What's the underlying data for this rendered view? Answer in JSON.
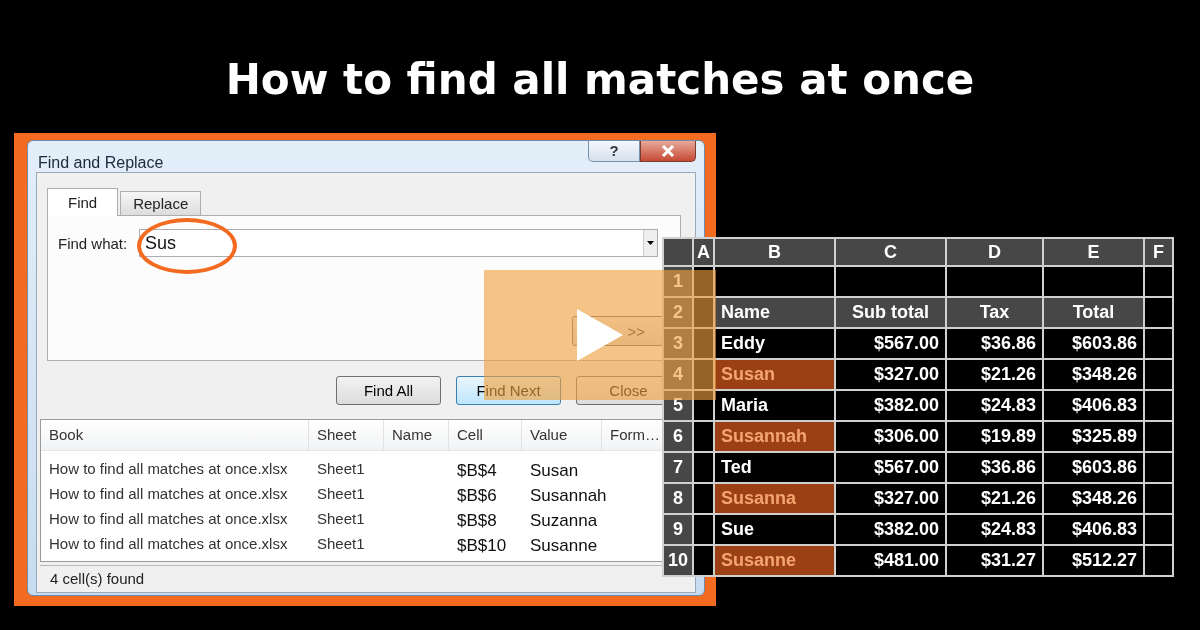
{
  "title": "How to find all matches at once",
  "dialog": {
    "title": "Find and Replace",
    "help_button": "?",
    "tabs": [
      {
        "label": "Find",
        "selected": true
      },
      {
        "label": "Replace",
        "selected": false
      }
    ],
    "find_what": {
      "label": "Find what:",
      "value": "Sus"
    },
    "options_button": ">>",
    "buttons": [
      "Find All",
      "Find Next",
      "Close"
    ],
    "results": {
      "columns": [
        "Book",
        "Sheet",
        "Name",
        "Cell",
        "Value",
        "Form…"
      ],
      "rows": [
        {
          "book": "How to find all matches at once.xlsx",
          "sheet": "Sheet1",
          "cell": "$B$4",
          "value": "Susan"
        },
        {
          "book": "How to find all matches at once.xlsx",
          "sheet": "Sheet1",
          "cell": "$B$6",
          "value": "Susannah"
        },
        {
          "book": "How to find all matches at once.xlsx",
          "sheet": "Sheet1",
          "cell": "$B$8",
          "value": "Suzanna"
        },
        {
          "book": "How to find all matches at once.xlsx",
          "sheet": "Sheet1",
          "cell": "$B$10",
          "value": "Susanne"
        }
      ]
    },
    "status": "4 cell(s) found"
  },
  "spreadsheet": {
    "column_headers": [
      "A",
      "B",
      "C",
      "D",
      "E",
      "F"
    ],
    "rows": [
      {
        "number": "1",
        "kind": "blank"
      },
      {
        "number": "2",
        "kind": "header",
        "cells": [
          "Name",
          "Sub total",
          "Tax",
          "Total"
        ]
      },
      {
        "number": "3",
        "kind": "data",
        "highlighted": false,
        "cells": [
          "Eddy",
          "$567.00",
          "$36.86",
          "$603.86"
        ]
      },
      {
        "number": "4",
        "kind": "data",
        "highlighted": true,
        "cells": [
          "Susan",
          "$327.00",
          "$21.26",
          "$348.26"
        ]
      },
      {
        "number": "5",
        "kind": "data",
        "highlighted": false,
        "cells": [
          "Maria",
          "$382.00",
          "$24.83",
          "$406.83"
        ]
      },
      {
        "number": "6",
        "kind": "data",
        "highlighted": true,
        "cells": [
          "Susannah",
          "$306.00",
          "$19.89",
          "$325.89"
        ]
      },
      {
        "number": "7",
        "kind": "data",
        "highlighted": false,
        "cells": [
          "Ted",
          "$567.00",
          "$36.86",
          "$603.86"
        ]
      },
      {
        "number": "8",
        "kind": "data",
        "highlighted": true,
        "cells": [
          "Susanna",
          "$327.00",
          "$21.26",
          "$348.26"
        ]
      },
      {
        "number": "9",
        "kind": "data",
        "highlighted": false,
        "cells": [
          "Sue",
          "$382.00",
          "$24.83",
          "$406.83"
        ]
      },
      {
        "number": "10",
        "kind": "data",
        "highlighted": true,
        "cells": [
          "Susanne",
          "$481.00",
          "$31.27",
          "$512.27"
        ]
      }
    ]
  }
}
